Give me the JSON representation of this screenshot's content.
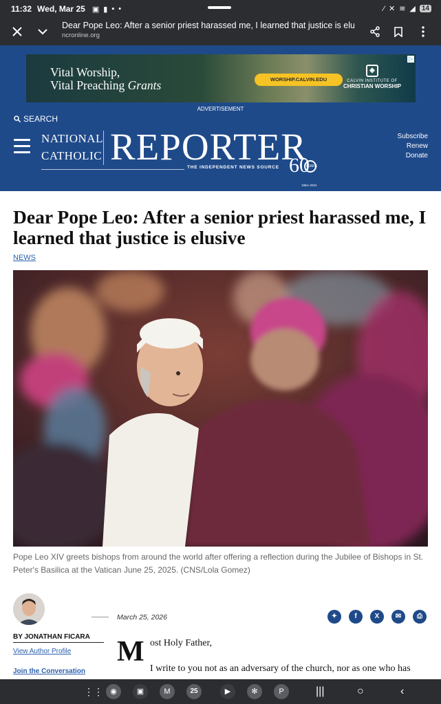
{
  "status_bar": {
    "time": "11:32",
    "date": "Wed, Mar 25",
    "battery": "14"
  },
  "browser": {
    "page_title": "Dear Pope Leo: After a senior priest harassed me, I learned that justice is elusi...",
    "domain": "ncronline.org",
    "icons": [
      "close-icon",
      "chevron-down-icon",
      "share-icon",
      "bookmark-icon",
      "more-vert-icon"
    ]
  },
  "ad": {
    "headline_line1": "Vital Worship,",
    "headline_line2a": "Vital Preaching ",
    "headline_line2b": "Grants",
    "cta": "WORSHIP.CALVIN.EDU",
    "sponsor_line1": "CALVIN INSTITUTE OF",
    "sponsor_line2": "CHRISTIAN WORSHIP",
    "label": "ADVERTISEMENT"
  },
  "site": {
    "search_label": "SEARCH",
    "logo_national": "NATIONAL",
    "logo_catholic": "CATHOLIC",
    "logo_reporter": "REPORTER",
    "tagline": "THE INDEPENDENT NEWS SOURCE",
    "anniversary": "60",
    "anniversary_label": "YEARS",
    "anniversary_span": "1964–2024",
    "links": [
      "Subscribe",
      "Renew",
      "Donate"
    ]
  },
  "article": {
    "headline": "Dear Pope Leo: After a senior priest harassed me, I learned that justice is elusive",
    "category": "NEWS",
    "caption": "Pope Leo XIV greets bishops from around the world after offering a reflection during the Jubilee of Bishops in St. Peter's Basilica at the Vatican June 25, 2025. (CNS/Lola Gomez)",
    "date": "March 25, 2026",
    "byline": "BY JONATHAN FICARA",
    "view_profile": "View Author Profile",
    "join": "Join the Conversation",
    "dropcap": "M",
    "salutation": "ost Holy Father,",
    "paragraph_start": "I write to you not as an adversary of the church, nor as one who has"
  },
  "share_icons": [
    "bluesky-icon",
    "facebook-icon",
    "x-icon",
    "email-icon",
    "print-icon"
  ],
  "nav": {
    "calendar_day": "25",
    "icons": [
      "app-drawer-icon",
      "chrome-icon",
      "camera-icon",
      "gmail-icon",
      "calendar-icon",
      "play-store-icon",
      "slack-icon",
      "pinterest-icon"
    ]
  }
}
